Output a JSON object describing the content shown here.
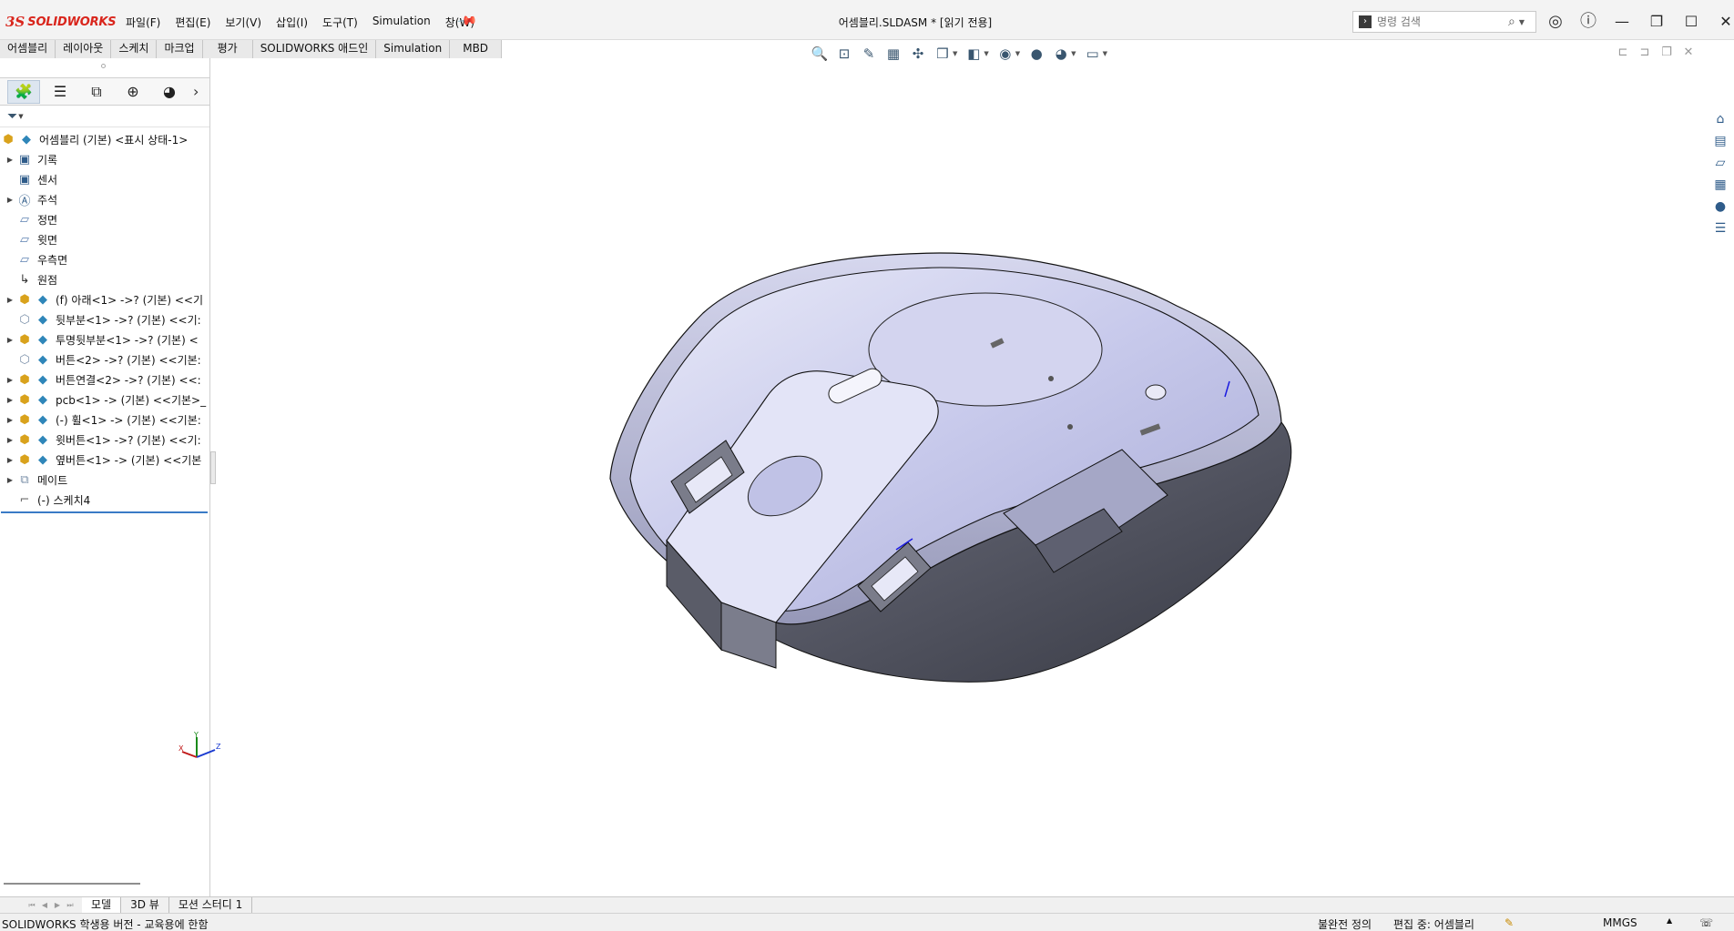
{
  "app": {
    "logo_mark": "3S",
    "logo_text": "SOLIDWORKS",
    "document_title": "어셈블리.SLDASM * [읽기 전용]"
  },
  "menu": {
    "items": [
      "파일(F)",
      "편집(E)",
      "보기(V)",
      "삽입(I)",
      "도구(T)",
      "Simulation",
      "창(W)"
    ]
  },
  "search": {
    "placeholder": "명령 검색"
  },
  "command_tabs": [
    "어셈블리",
    "레이아웃",
    "스케치",
    "마크업",
    "평가",
    "SOLIDWORKS 애드인",
    "Simulation",
    "MBD"
  ],
  "feature_tree": {
    "root": "어셈블리 (기본) <표시 상태-1>",
    "items": [
      {
        "label": "기록",
        "icon": "history-folder-icon",
        "expand": true
      },
      {
        "label": "센서",
        "icon": "sensor-folder-icon",
        "expand": false
      },
      {
        "label": "주석",
        "icon": "annotation-folder-icon",
        "expand": true
      },
      {
        "label": "정면",
        "icon": "plane-icon",
        "expand": false
      },
      {
        "label": "윗면",
        "icon": "plane-icon",
        "expand": false
      },
      {
        "label": "우측면",
        "icon": "plane-icon",
        "expand": false
      },
      {
        "label": "원점",
        "icon": "origin-icon",
        "expand": false
      },
      {
        "label": "(f) 아래<1> ->? (기본) <<기",
        "icon": "subassembly-icon",
        "expand": true
      },
      {
        "label": "뒷부분<1> ->? (기본) <<기:",
        "icon": "part-icon",
        "expand": false
      },
      {
        "label": "투명뒷부분<1> ->? (기본) <",
        "icon": "subassembly-icon",
        "expand": true
      },
      {
        "label": "버튼<2> ->? (기본) <<기본:",
        "icon": "part-icon",
        "expand": false
      },
      {
        "label": "버튼연결<2> ->? (기본) <<:",
        "icon": "subassembly-icon",
        "expand": true
      },
      {
        "label": "pcb<1> -> (기본) <<기본>_",
        "icon": "subassembly-icon",
        "expand": true
      },
      {
        "label": "(-) 휠<1> -> (기본) <<기본:",
        "icon": "subassembly-icon",
        "expand": true
      },
      {
        "label": "윗버튼<1> ->? (기본) <<기:",
        "icon": "subassembly-icon",
        "expand": true
      },
      {
        "label": "옆버튼<1> -> (기본) <<기본",
        "icon": "subassembly-icon",
        "expand": true
      },
      {
        "label": "메이트",
        "icon": "mate-icon",
        "expand": true
      },
      {
        "label": "(-) 스케치4",
        "icon": "sketch-icon",
        "expand": false
      }
    ]
  },
  "bottom_tabs": [
    "모델",
    "3D 뷰",
    "모션 스터디 1"
  ],
  "status": {
    "left": "SOLIDWORKS 학생용 버전 - 교육용에 한함",
    "definition": "불완전 정의",
    "editing": "편집 중: 어셈블리",
    "units": "MMGS"
  },
  "triad": {
    "x": "X",
    "y": "Y",
    "z": "Z"
  },
  "colors": {
    "brand": "#d9251c",
    "accent": "#3a7bc6",
    "model_face": "#c9cbe8",
    "model_shadow": "#4a4c55"
  }
}
